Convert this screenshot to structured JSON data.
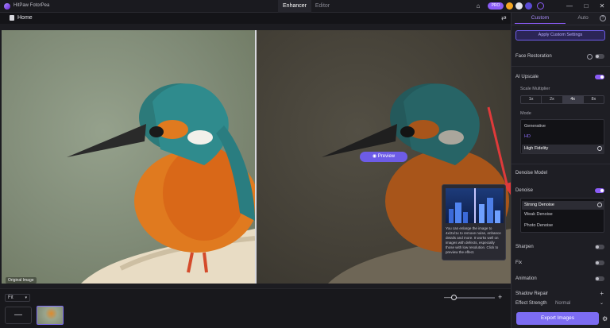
{
  "app": {
    "name": "HitPaw FotorPea"
  },
  "top_tabs": [
    {
      "label": "Enhancer"
    },
    {
      "label": "Editor"
    }
  ],
  "titlebar": {
    "pro_label": "PRO",
    "win_min": "—",
    "win_max": "□",
    "win_close": "✕"
  },
  "crumb": {
    "label": "Home"
  },
  "canvas": {
    "original_label": "Original Image",
    "preview_label": "Preview"
  },
  "tooltip": {
    "text": "You can enlarge the image to 4x/2x/1x to remove noise, enhance details and more. It works well on images with defects, especially those with low resolution. Click to preview the effect."
  },
  "bottombar": {
    "dropdown_label": "Fit",
    "add_label": "—",
    "zoom_minus": "—",
    "zoom_plus": "+"
  },
  "panel": {
    "tab_custom": "Custom",
    "tab_auto": "Auto",
    "primary_button": "Apply Custom Settings",
    "face_restoration": "Face Restoration",
    "ai_upscale": "AI Upscale",
    "scale_label": "Scale Multiplier",
    "scale_options": [
      "1x",
      "2x",
      "4x",
      "8x"
    ],
    "scale_selected": "4x",
    "mode_label": "Mode",
    "modes": [
      "Generative",
      "HD",
      "High Fidelity"
    ],
    "color_denoise_section": "Denoise Model",
    "denoise_label": "Denoise",
    "denoise_options": [
      "Strong Denoise",
      "Weak Denoise",
      "Photo Denoise"
    ],
    "rows": [
      "Sharpen",
      "Fix",
      "Animation"
    ],
    "shadow_repair": "Shadow Repair",
    "effect_label": "Effect Strength",
    "effect_value": "Normal",
    "export_label": "Export Images"
  }
}
